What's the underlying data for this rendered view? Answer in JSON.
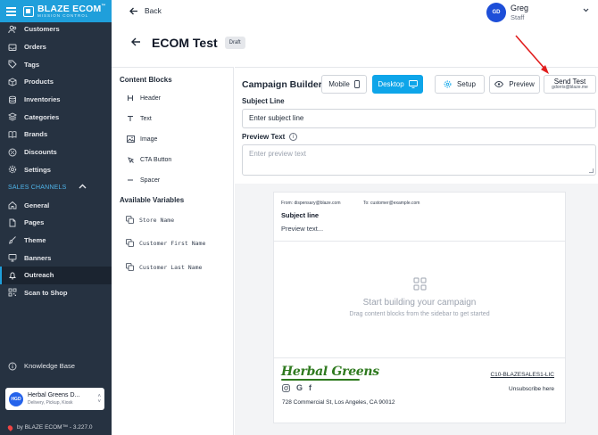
{
  "brand": {
    "title": "BLAZE ECOM",
    "trademark": "™",
    "subtitle": "MISSION CONTROL"
  },
  "sidebar": {
    "items": [
      {
        "label": "Customers",
        "icon": "users-icon"
      },
      {
        "label": "Orders",
        "icon": "inbox-icon"
      },
      {
        "label": "Tags",
        "icon": "tag-icon"
      },
      {
        "label": "Products",
        "icon": "box-icon"
      },
      {
        "label": "Inventories",
        "icon": "database-icon"
      },
      {
        "label": "Categories",
        "icon": "layers-icon"
      },
      {
        "label": "Brands",
        "icon": "book-icon"
      },
      {
        "label": "Discounts",
        "icon": "discount-icon"
      },
      {
        "label": "Settings",
        "icon": "gear-icon"
      }
    ],
    "section_label": "SALES CHANNELS",
    "channel_items": [
      {
        "label": "General",
        "icon": "home-icon"
      },
      {
        "label": "Pages",
        "icon": "file-icon"
      },
      {
        "label": "Theme",
        "icon": "brush-icon"
      },
      {
        "label": "Banners",
        "icon": "monitor-icon"
      },
      {
        "label": "Outreach",
        "icon": "bell-icon",
        "active": true
      },
      {
        "label": "Scan to Shop",
        "icon": "qr-icon"
      }
    ],
    "knowledge_base": "Knowledge Base",
    "org": {
      "initials": "HGD",
      "name": "Herbal Greens D...",
      "services": "Delivery, Pickup, Kiosk"
    },
    "footer": "by BLAZE ECOM™ - 3.227.0"
  },
  "topbar": {
    "back_label": "Back",
    "user": {
      "initials": "GD",
      "name": "Greg",
      "role": "Staff"
    }
  },
  "page": {
    "title": "ECOM Test",
    "status_badge": "Draft"
  },
  "content_blocks": {
    "title": "Content Blocks",
    "items": [
      {
        "label": "Header",
        "icon": "heading-icon"
      },
      {
        "label": "Text",
        "icon": "text-icon"
      },
      {
        "label": "Image",
        "icon": "image-icon"
      },
      {
        "label": "CTA Button",
        "icon": "cta-icon"
      },
      {
        "label": "Spacer",
        "icon": "spacer-icon"
      }
    ]
  },
  "variables": {
    "title": "Available Variables",
    "items": [
      "Store Name",
      "Customer First Name",
      "Customer Last Name"
    ]
  },
  "builder": {
    "title": "Campaign Builder",
    "mobile_label": "Mobile",
    "desktop_label": "Desktop",
    "setup_label": "Setup",
    "preview_label": "Preview",
    "send_test_label": "Send Test",
    "send_test_email": "gdorris@blaze.me",
    "subject_label": "Subject Line",
    "subject_value": "Enter subject line",
    "preview_text_label": "Preview Text",
    "preview_text_placeholder": "Enter preview text"
  },
  "email": {
    "from": "From: dispensary@blaze.com",
    "to": "To: customer@example.com",
    "subject": "Subject line",
    "preview": "Preview text...",
    "empty_title": "Start building your campaign",
    "empty_subtitle": "Drag content blocks from the sidebar to get started",
    "brand_name": "Herbal Greens",
    "code": "C10-BLAZESALES1-LIC",
    "unsubscribe": "Unsubscribe here",
    "address": "728 Commercial St, Los Angeles, CA 90012"
  },
  "colors": {
    "sidebar": "#263241",
    "accent": "#1f9fdb",
    "primary_button": "#0ea5e9",
    "brand_green": "#2f7a1f",
    "annotation_arrow": "#e11d1d"
  }
}
